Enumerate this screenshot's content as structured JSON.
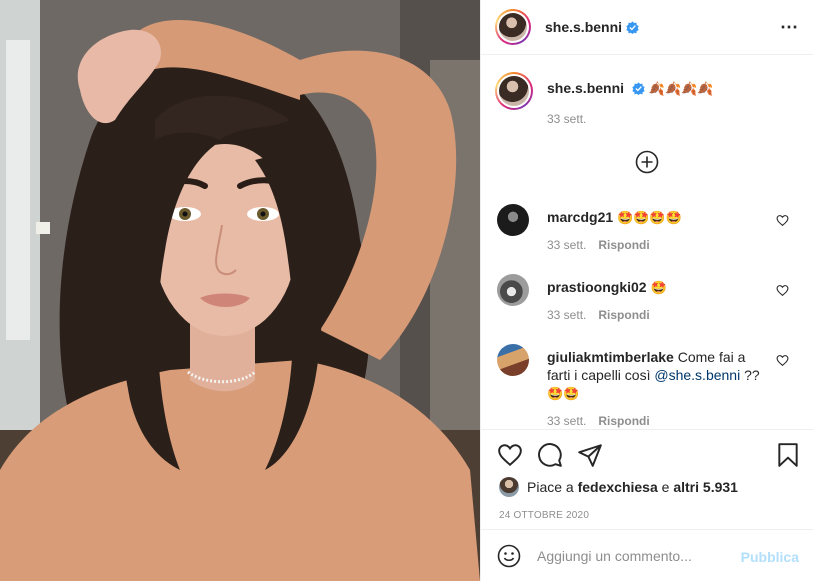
{
  "post": {
    "username": "she.s.benni",
    "caption_text": "🍂🍂🍂🍂",
    "caption_time": "33 sett.",
    "more_icon": "⋯",
    "comments": [
      {
        "user": "marcdg21",
        "text": "🤩🤩🤩🤩",
        "time": "33 sett.",
        "reply": "Rispondi"
      },
      {
        "user": "prastioongki02",
        "text": "🤩",
        "time": "33 sett.",
        "reply": "Rispondi"
      },
      {
        "user": "giuliakmtimberlake",
        "text_before": "Come fai a farti i capelli così ",
        "mention": "@she.s.benni",
        "text_after": " ??",
        "emojis": "🤩🤩",
        "time": "33 sett.",
        "reply": "Rispondi"
      }
    ],
    "likes_prefix": "Piace a ",
    "likes_user": "fedexchiesa",
    "likes_middle": " e ",
    "likes_count": "altri 5.931",
    "date": "24 OTTOBRE 2020",
    "comment_placeholder": "Aggiungi un commento...",
    "publish_label": "Pubblica"
  },
  "colors": {
    "verified": "#3897f0",
    "publish_disabled": "#b2dffc",
    "secondary_text": "#8e8e8e"
  }
}
